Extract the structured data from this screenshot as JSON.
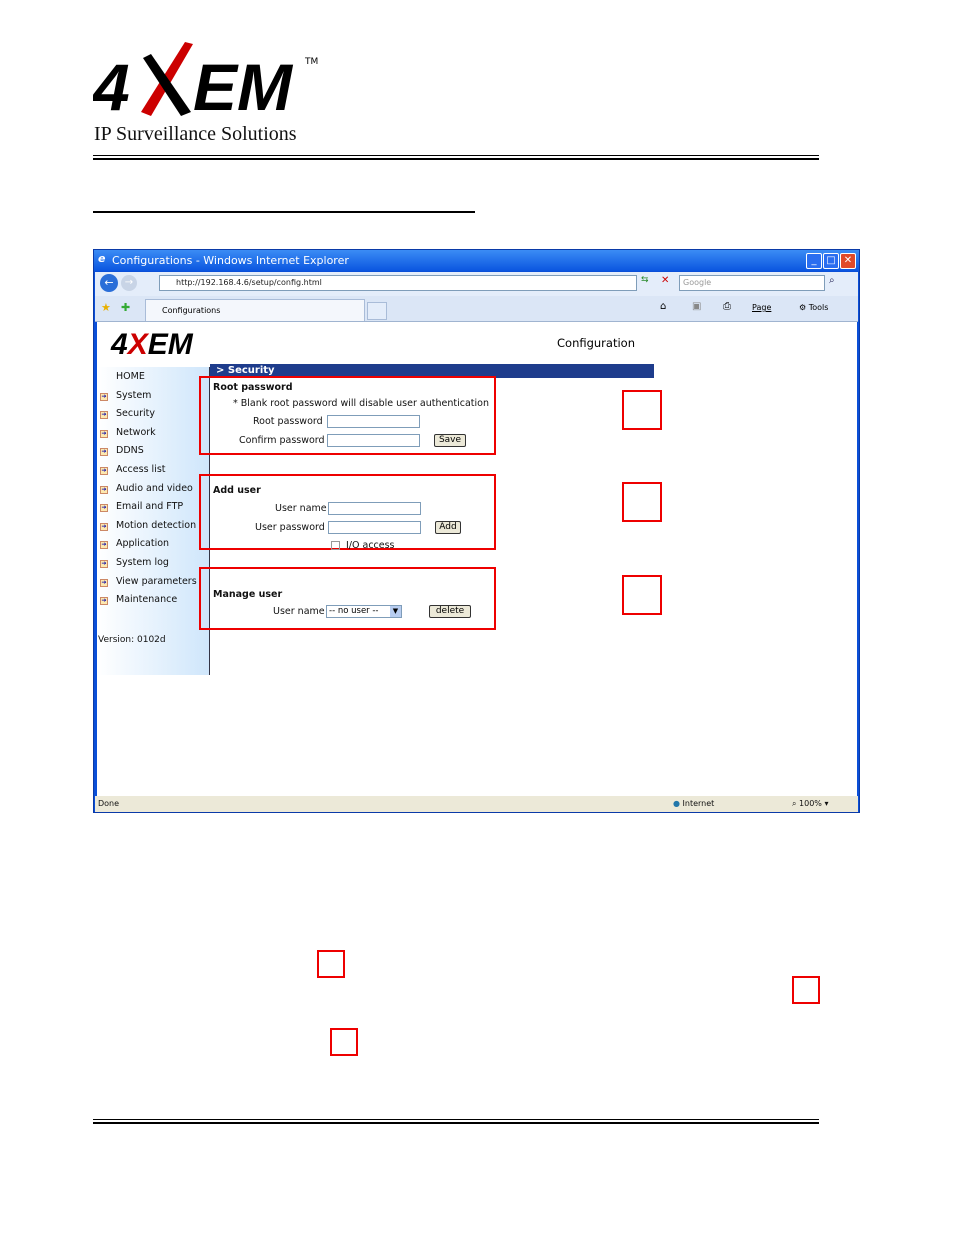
{
  "document": {
    "logo_text": "4XEM",
    "trademark": "TM",
    "tagline": "IP Surveillance Solutions"
  },
  "browser": {
    "title": "Configurations - Windows Internet Explorer",
    "url": "http://192.168.4.6/setup/config.html",
    "search_placeholder": "Google",
    "tab_label": "Configurations",
    "toolbar": {
      "page": "Page",
      "tools": "Tools"
    },
    "status": "Done",
    "zone": "Internet",
    "zoom": "100%"
  },
  "page": {
    "logo_text": "4XEM",
    "heading": "Configuration",
    "section": "> Security",
    "sidebar": [
      "HOME",
      "System",
      "Security",
      "Network",
      "DDNS",
      "Access list",
      "Audio and video",
      "Email and FTP",
      "Motion detection",
      "Application",
      "System log",
      "View parameters",
      "Maintenance"
    ],
    "version": "Version: 0102d",
    "root": {
      "title": "Root password",
      "note": "* Blank root password will disable user authentication",
      "root_label": "Root password",
      "confirm_label": "Confirm password",
      "save": "Save"
    },
    "add": {
      "title": "Add user",
      "name_label": "User name",
      "pass_label": "User password",
      "add": "Add",
      "io": "I/O access"
    },
    "manage": {
      "title": "Manage user",
      "name_label": "User name",
      "select_value": "-- no user --",
      "delete": "delete"
    }
  },
  "colors": {
    "annotation": "#e00000",
    "section_bar": "#1e3c8c",
    "titlebar": "#0a55e0"
  }
}
